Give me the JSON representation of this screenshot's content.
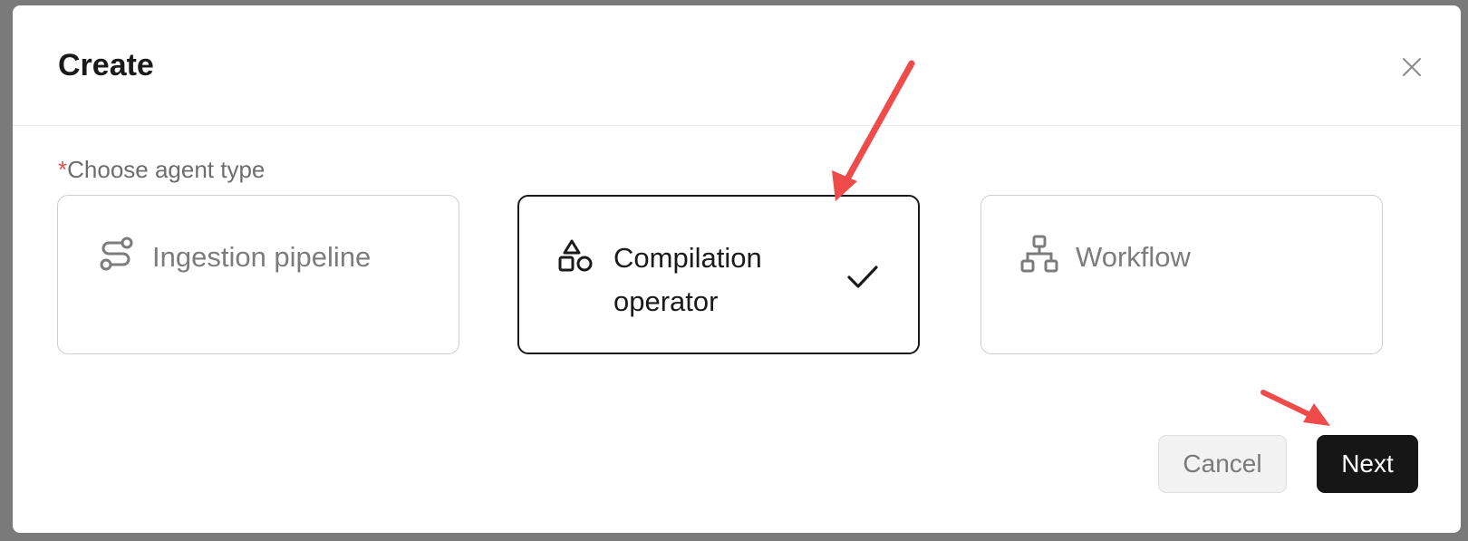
{
  "dialog": {
    "title": "Create",
    "close_icon": "close-icon"
  },
  "form": {
    "required_mark": "*",
    "label": "Choose agent type",
    "options": [
      {
        "label": "Ingestion pipeline",
        "icon": "route-icon",
        "selected": false
      },
      {
        "label": "Compilation operator",
        "icon": "shapes-icon",
        "selected": true
      },
      {
        "label": "Workflow",
        "icon": "hierarchy-icon",
        "selected": false
      }
    ]
  },
  "footer": {
    "cancel_label": "Cancel",
    "next_label": "Next"
  },
  "annotations": {
    "arrow_color": "#f04b4b"
  },
  "colors": {
    "primary_button": "#161616",
    "required": "#d9534f"
  }
}
